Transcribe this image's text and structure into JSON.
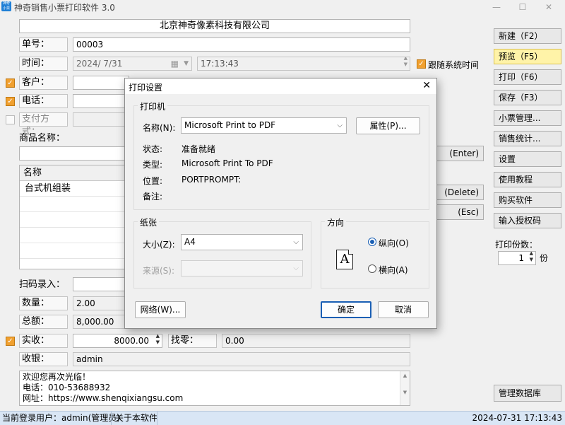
{
  "window": {
    "title": "神奇销售小票打印软件 3.0",
    "icon_text": "神奇小票",
    "minimize": "—",
    "maximize": "☐",
    "close": "✕"
  },
  "form": {
    "company": "北京神奇像素科技有限公司",
    "order_no_label": "单号：",
    "order_no": "00003",
    "time_label": "时间：",
    "date": "2024/  7/31",
    "time": "17:13:43",
    "follow_system_time": "跟随系统时间",
    "customer_label": "客户：",
    "phone_label": "电话：",
    "payment_label": "支付方式：",
    "goods_name_label": "商品名称：",
    "enter_suffix": "(Enter)",
    "delete_suffix": "(Delete)",
    "esc_suffix": "(Esc)",
    "table_header": "名称",
    "table_rows": [
      "台式机组装"
    ],
    "scan_label": "扫码录入：",
    "qty_label": "数量：",
    "qty": "2.00",
    "total_label": "总额：",
    "total": "8,000.00",
    "paid_label": "实收：",
    "paid": "8000.00",
    "change_label": "找零：",
    "change": "0.00",
    "cashier_label": "收银：",
    "cashier": "admin",
    "footer_lines": [
      "欢迎您再次光临！",
      "电话：010-53688932",
      "网址：https://www.shenqixiangsu.com"
    ]
  },
  "sidebar": {
    "buttons": [
      "新建（F2）",
      "预览（F5）",
      "打印（F6）",
      "保存（F3）",
      "小票管理...",
      "销售统计...",
      "设置",
      "使用教程",
      "购买软件",
      "输入授权码"
    ],
    "copies_label": "打印份数：",
    "copies_value": "1",
    "copies_unit": "份",
    "manage_db": "管理数据库"
  },
  "statusbar": {
    "user": "当前登录用户：admin(管理员)",
    "about": "关于本软件",
    "datetime": "2024-07-31 17:13:43"
  },
  "dialog": {
    "title": "打印设置",
    "close": "✕",
    "printer_group": "打印机",
    "name_label": "名称(N):",
    "printer_name": "Microsoft Print to PDF",
    "properties_btn": "属性(P)...",
    "status_label": "状态:",
    "status_value": "准备就绪",
    "type_label": "类型:",
    "type_value": "Microsoft Print To PDF",
    "location_label": "位置:",
    "location_value": "PORTPROMPT:",
    "comment_label": "备注:",
    "paper_group": "纸张",
    "size_label": "大小(Z):",
    "size_value": "A4",
    "source_label": "来源(S):",
    "orientation_group": "方向",
    "portrait": "纵向(O)",
    "landscape": "横向(A)",
    "orientation_glyph": "A",
    "network_btn": "网络(W)...",
    "ok_btn": "确定",
    "cancel_btn": "取消"
  }
}
